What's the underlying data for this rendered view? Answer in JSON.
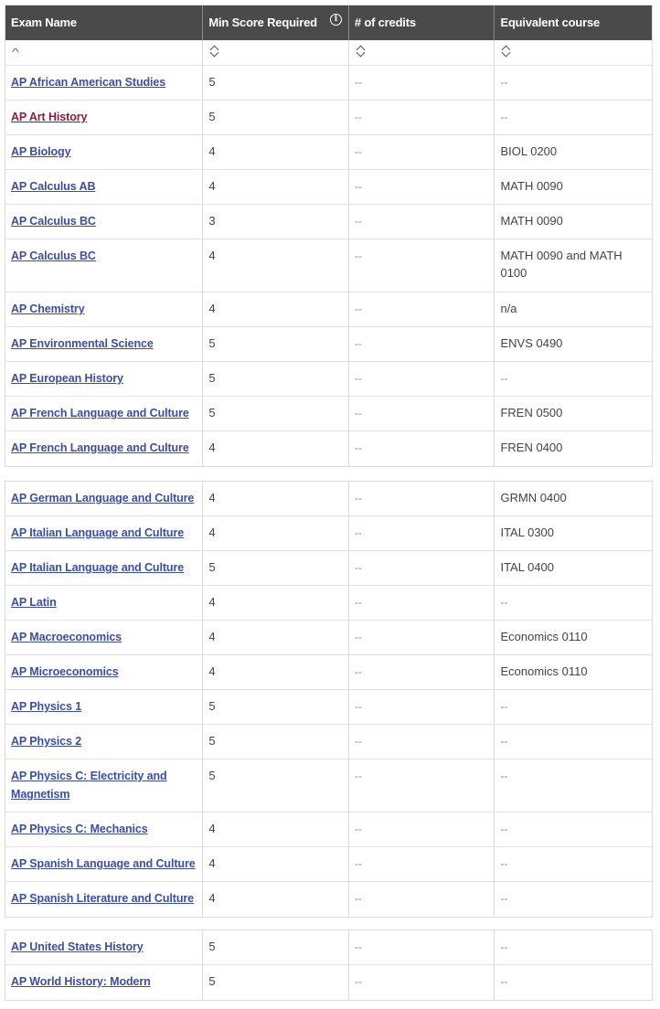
{
  "header": {
    "columns": [
      {
        "label": "Exam Name"
      },
      {
        "label": "Min Score Required",
        "info_icon": "info-icon"
      },
      {
        "label": "# of credits"
      },
      {
        "label": "Equivalent course"
      }
    ]
  },
  "sort_controls": {
    "exam_name": "^",
    "min_score": "sort-both",
    "credits": "sort-both",
    "course": "sort-both"
  },
  "colors": {
    "header_bg": "#4a4a4a",
    "link": "#3b4ea6",
    "visited_link": "#8a1c3c"
  },
  "groups": [
    {
      "rows": [
        {
          "exam": "AP African American Studies",
          "score": "5",
          "credits": "--",
          "course": "--"
        },
        {
          "exam": "AP Art History",
          "score": "5",
          "credits": "--",
          "course": "--",
          "visited": true
        },
        {
          "exam": "AP Biology",
          "score": "4",
          "credits": "--",
          "course": "BIOL 0200"
        },
        {
          "exam": "AP Calculus AB",
          "score": "4",
          "credits": "--",
          "course": "MATH 0090"
        },
        {
          "exam": "AP Calculus BC",
          "score": "3",
          "credits": "--",
          "course": "MATH 0090"
        },
        {
          "exam": "AP Calculus BC",
          "score": "4",
          "credits": "--",
          "course": "MATH 0090 and MATH 0100"
        },
        {
          "exam": "AP Chemistry",
          "score": "4",
          "credits": "--",
          "course": "n/a"
        },
        {
          "exam": "AP Environmental Science",
          "score": "5",
          "credits": "--",
          "course": "ENVS 0490"
        },
        {
          "exam": "AP European History",
          "score": "5",
          "credits": "--",
          "course": "--"
        },
        {
          "exam": "AP French Language and Culture",
          "score": "5",
          "credits": "--",
          "course": "FREN 0500"
        },
        {
          "exam": "AP French Language and Culture",
          "score": "4",
          "credits": "--",
          "course": "FREN 0400"
        }
      ]
    },
    {
      "rows": [
        {
          "exam": "AP German Language and Culture",
          "score": "4",
          "credits": "--",
          "course": "GRMN 0400"
        },
        {
          "exam": "AP Italian Language and Culture",
          "score": "4",
          "credits": "--",
          "course": "ITAL 0300"
        },
        {
          "exam": "AP Italian Language and Culture",
          "score": "5",
          "credits": "--",
          "course": "ITAL 0400"
        },
        {
          "exam": "AP Latin",
          "score": "4",
          "credits": "--",
          "course": "--"
        },
        {
          "exam": "AP Macroeconomics",
          "score": "4",
          "credits": "--",
          "course": "Economics 0110"
        },
        {
          "exam": "AP Microeconomics",
          "score": "4",
          "credits": "--",
          "course": "Economics 0110"
        },
        {
          "exam": "AP Physics 1",
          "score": "5",
          "credits": "--",
          "course": "--"
        },
        {
          "exam": "AP Physics 2",
          "score": "5",
          "credits": "--",
          "course": "--"
        },
        {
          "exam": "AP Physics C: Electricity and Magnetism",
          "score": "5",
          "credits": "--",
          "course": "--"
        },
        {
          "exam": "AP Physics C: Mechanics",
          "score": "4",
          "credits": "--",
          "course": "--"
        },
        {
          "exam": "AP Spanish Language and Culture",
          "score": "4",
          "credits": "--",
          "course": "--"
        },
        {
          "exam": "AP Spanish Literature and Culture",
          "score": "4",
          "credits": "--",
          "course": "--"
        }
      ]
    },
    {
      "rows": [
        {
          "exam": "AP United States History",
          "score": "5",
          "credits": "--",
          "course": "--"
        },
        {
          "exam": "AP World History: Modern",
          "score": "5",
          "credits": "--",
          "course": "--"
        }
      ]
    }
  ]
}
